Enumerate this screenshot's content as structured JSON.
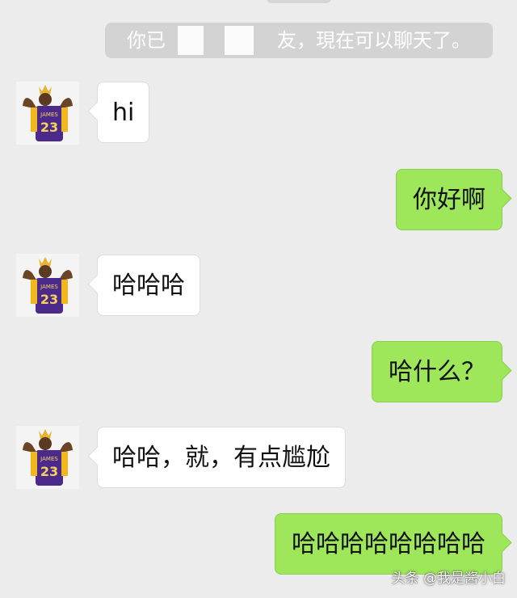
{
  "colors": {
    "background": "#ececec",
    "received_bubble": "#ffffff",
    "sent_bubble": "#9ee65a",
    "system_notice": "#d3d3d3"
  },
  "system_notice": {
    "text_before": "你已",
    "text_after": "友，現在可以聊天了。"
  },
  "messages": [
    {
      "side": "received",
      "text": "hi",
      "avatar_icon": "player-23-avatar-icon"
    },
    {
      "side": "sent",
      "text": "你好啊"
    },
    {
      "side": "received",
      "text": "哈哈哈",
      "avatar_icon": "player-23-avatar-icon"
    },
    {
      "side": "sent",
      "text": "哈什么？"
    },
    {
      "side": "received",
      "text": "哈哈，就，有点尴尬",
      "avatar_icon": "player-23-avatar-icon"
    },
    {
      "side": "sent",
      "text": "哈哈哈哈哈哈哈哈"
    }
  ],
  "avatar": {
    "jersey_text": "JAMES",
    "jersey_number": "23"
  },
  "watermark": "头条 @我是酱小白"
}
